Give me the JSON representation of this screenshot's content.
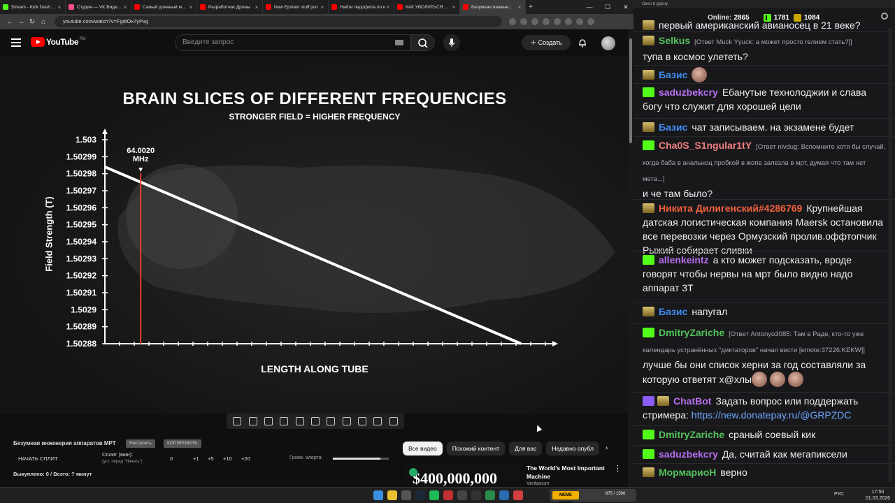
{
  "browser": {
    "tabs": [
      {
        "label": "Stream - Kick Dashboard",
        "color": "#53fc18"
      },
      {
        "label": "Студия — VK Видео Live",
        "color": "#ff4d88"
      },
      {
        "label": "Самый длинный мост",
        "color": "#ff0000"
      },
      {
        "label": "Разработчик Дроны",
        "color": "#ff0000"
      },
      {
        "label": "New Epstein stuff just",
        "color": "#ff0000"
      },
      {
        "label": "Найти педофила по к",
        "color": "#ff0000"
      },
      {
        "label": "КАК УВОЛИТЬСЯ И П",
        "color": "#ff0000"
      },
      {
        "label": "Безумная инжене...",
        "color": "#ff0000"
      }
    ],
    "url": "youtube.com/watch?v=FgdiOx7yPvg"
  },
  "youtube": {
    "logo_text": "YouTube",
    "region": "RU",
    "search_placeholder": "Введите запрос",
    "create_label": "Создать",
    "chips": [
      "Все видео",
      "Похожий контент",
      "Для вас",
      "Недавно опубл"
    ],
    "recommendation": {
      "thumb_text": "$400,000,000",
      "title": "The World's Most Important Machine",
      "channel": "Veritasium"
    }
  },
  "video": {
    "title": "BRAIN SLICES OF DIFFERENT FREQUENCIES",
    "subtitle": "STRONGER FIELD = HIGHER FREQUENCY",
    "xlabel": "LENGTH ALONG TUBE",
    "ylabel": "Field Strength (T)",
    "marker_label": "64.0020\nMHz",
    "marker_value": "64.0020",
    "marker_unit": "MHz"
  },
  "chart_data": {
    "type": "line",
    "title": "BRAIN SLICES OF DIFFERENT FREQUENCIES",
    "subtitle": "STRONGER FIELD = HIGHER FREQUENCY",
    "xlabel": "LENGTH ALONG TUBE",
    "ylabel": "Field Strength (T)",
    "y_ticks": [
      "1.503",
      "1.50299",
      "1.50298",
      "1.50297",
      "1.50296",
      "1.50295",
      "1.50294",
      "1.50293",
      "1.50292",
      "1.50291",
      "1.5029",
      "1.50289",
      "1.50288"
    ],
    "y_tick_values": [
      1.503,
      1.50299,
      1.50298,
      1.50297,
      1.50296,
      1.50295,
      1.50294,
      1.50293,
      1.50292,
      1.50291,
      1.5029,
      1.50289,
      1.50288
    ],
    "ylim": [
      1.50288,
      1.503
    ],
    "xlim": [
      0,
      1
    ],
    "series": [
      {
        "x": [
          0,
          0.93
        ],
        "y": [
          1.502984,
          1.50288
        ]
      }
    ],
    "marker": {
      "x": 0.08,
      "label": "64.0020 MHz"
    },
    "grid": false
  },
  "split": {
    "title": "Безумная инженерия аппаратов МРТ",
    "btn_settings": "Настроить",
    "btn_copy": "КОПИРОВАТЬ",
    "start": "НАЧАТЬ СПЛИТ",
    "split_min_label": "Сплит (мин):",
    "split_hint": "(уст. перед \"Начать\")",
    "nums": [
      "0",
      "+1",
      "+5",
      "+10",
      "+20"
    ],
    "alert_label": "Громк. алерта:",
    "alert_level": 0.85,
    "redeemed": "Выкуплено: 0 / Всего: ? минут"
  },
  "chat": {
    "window_title": "Окно в дерну",
    "online_label": "Online:",
    "online_count": "2865",
    "kick_count": "1781",
    "other_count": "1084",
    "messages": [
      {
        "badge": "tr",
        "user": "",
        "color": "#efeff1",
        "reply": "",
        "text": "первый американский авианосец в 21 веке?",
        "emotes": 0
      },
      {
        "badge": "tr",
        "user": "Selkus",
        "color": "#53c25a",
        "reply": "[Ответ Muck Yyuck: а может просто гелием стать?]]",
        "text": "тупа в космос улететь?",
        "emotes": 0
      },
      {
        "badge": "tr",
        "user": "Базис",
        "color": "#3f8bf0",
        "reply": "",
        "text": "",
        "emotes": 1
      },
      {
        "badge": "k",
        "user": "saduzbekcry",
        "color": "#b870f0",
        "reply": "",
        "text": "Ебанутые технолоджии и слава богу что служит для хорошей цели",
        "emotes": 0
      },
      {
        "badge": "tr",
        "user": "Базис",
        "color": "#3f8bf0",
        "reply": "",
        "text": "чат записываем. на экзамене будет",
        "emotes": 0
      },
      {
        "badge": "k",
        "user": "Cha0S_S1ngular1tY",
        "color": "#f08080",
        "reply": "[Ответ nivdug: Вспомните хотя бы случай, когда баба в анальноц пробкой в жопе залезла в мрт, думая что там нет мета...]",
        "text": "и че там было?",
        "emotes": 0
      },
      {
        "badge": "tr",
        "user": "Никита Дилигенский#4286769",
        "color": "#f0603c",
        "reply": "",
        "text": "Крупнейшая датская логистическая компания Maersk остановила все перевозки через Ормузский пролив.оффтопчик Рыжий собирает сливки",
        "emotes": 0
      },
      {
        "badge": "k",
        "user": "allenkeintz",
        "color": "#b870f0",
        "reply": "",
        "text": "а кто может подсказать, вроде говорят чтобы нервы на мрт было видно надо аппарат 3Т",
        "emotes": 0
      },
      {
        "badge": "tr",
        "user": "Базис",
        "color": "#3f8bf0",
        "reply": "",
        "text": "напугал",
        "emotes": 0
      },
      {
        "badge": "k",
        "user": "DmitryZariche",
        "color": "#53c25a",
        "reply": "[Ответ Antonyo3085: Там в Раде, кто-то уже календарь устранённых \"диктаторов\" начал вести [emote:37226:KEKW]]",
        "text": "лучше бы они список херни за год составляли за которую ответят х@хлы",
        "emotes": 3
      },
      {
        "badge": "bot",
        "user": "ChatBot",
        "color": "#b870f0",
        "reply": "",
        "text": "Задать вопрос или поддержать стримера:",
        "link": "https://new.donatepay.ru/@GRPZDC",
        "emotes": 0
      },
      {
        "badge": "k",
        "user": "DmitryZariche",
        "color": "#53c25a",
        "reply": "",
        "text": "сраный соевый кик",
        "emotes": 0
      },
      {
        "badge": "k",
        "user": "saduzbekcry",
        "color": "#b870f0",
        "reply": "",
        "text": "Да, считай как мегапиксели",
        "emotes": 0
      },
      {
        "badge": "tr",
        "user": "МормариоН",
        "color": "#53c25a",
        "reply": "",
        "text": "верно",
        "emotes": 0
      }
    ]
  },
  "taskbar": {
    "widget_label": "MEME PARTY",
    "widget_value": "875 / 1500",
    "lang": "РУС",
    "time": "17:50",
    "date": "01.03.2026"
  }
}
